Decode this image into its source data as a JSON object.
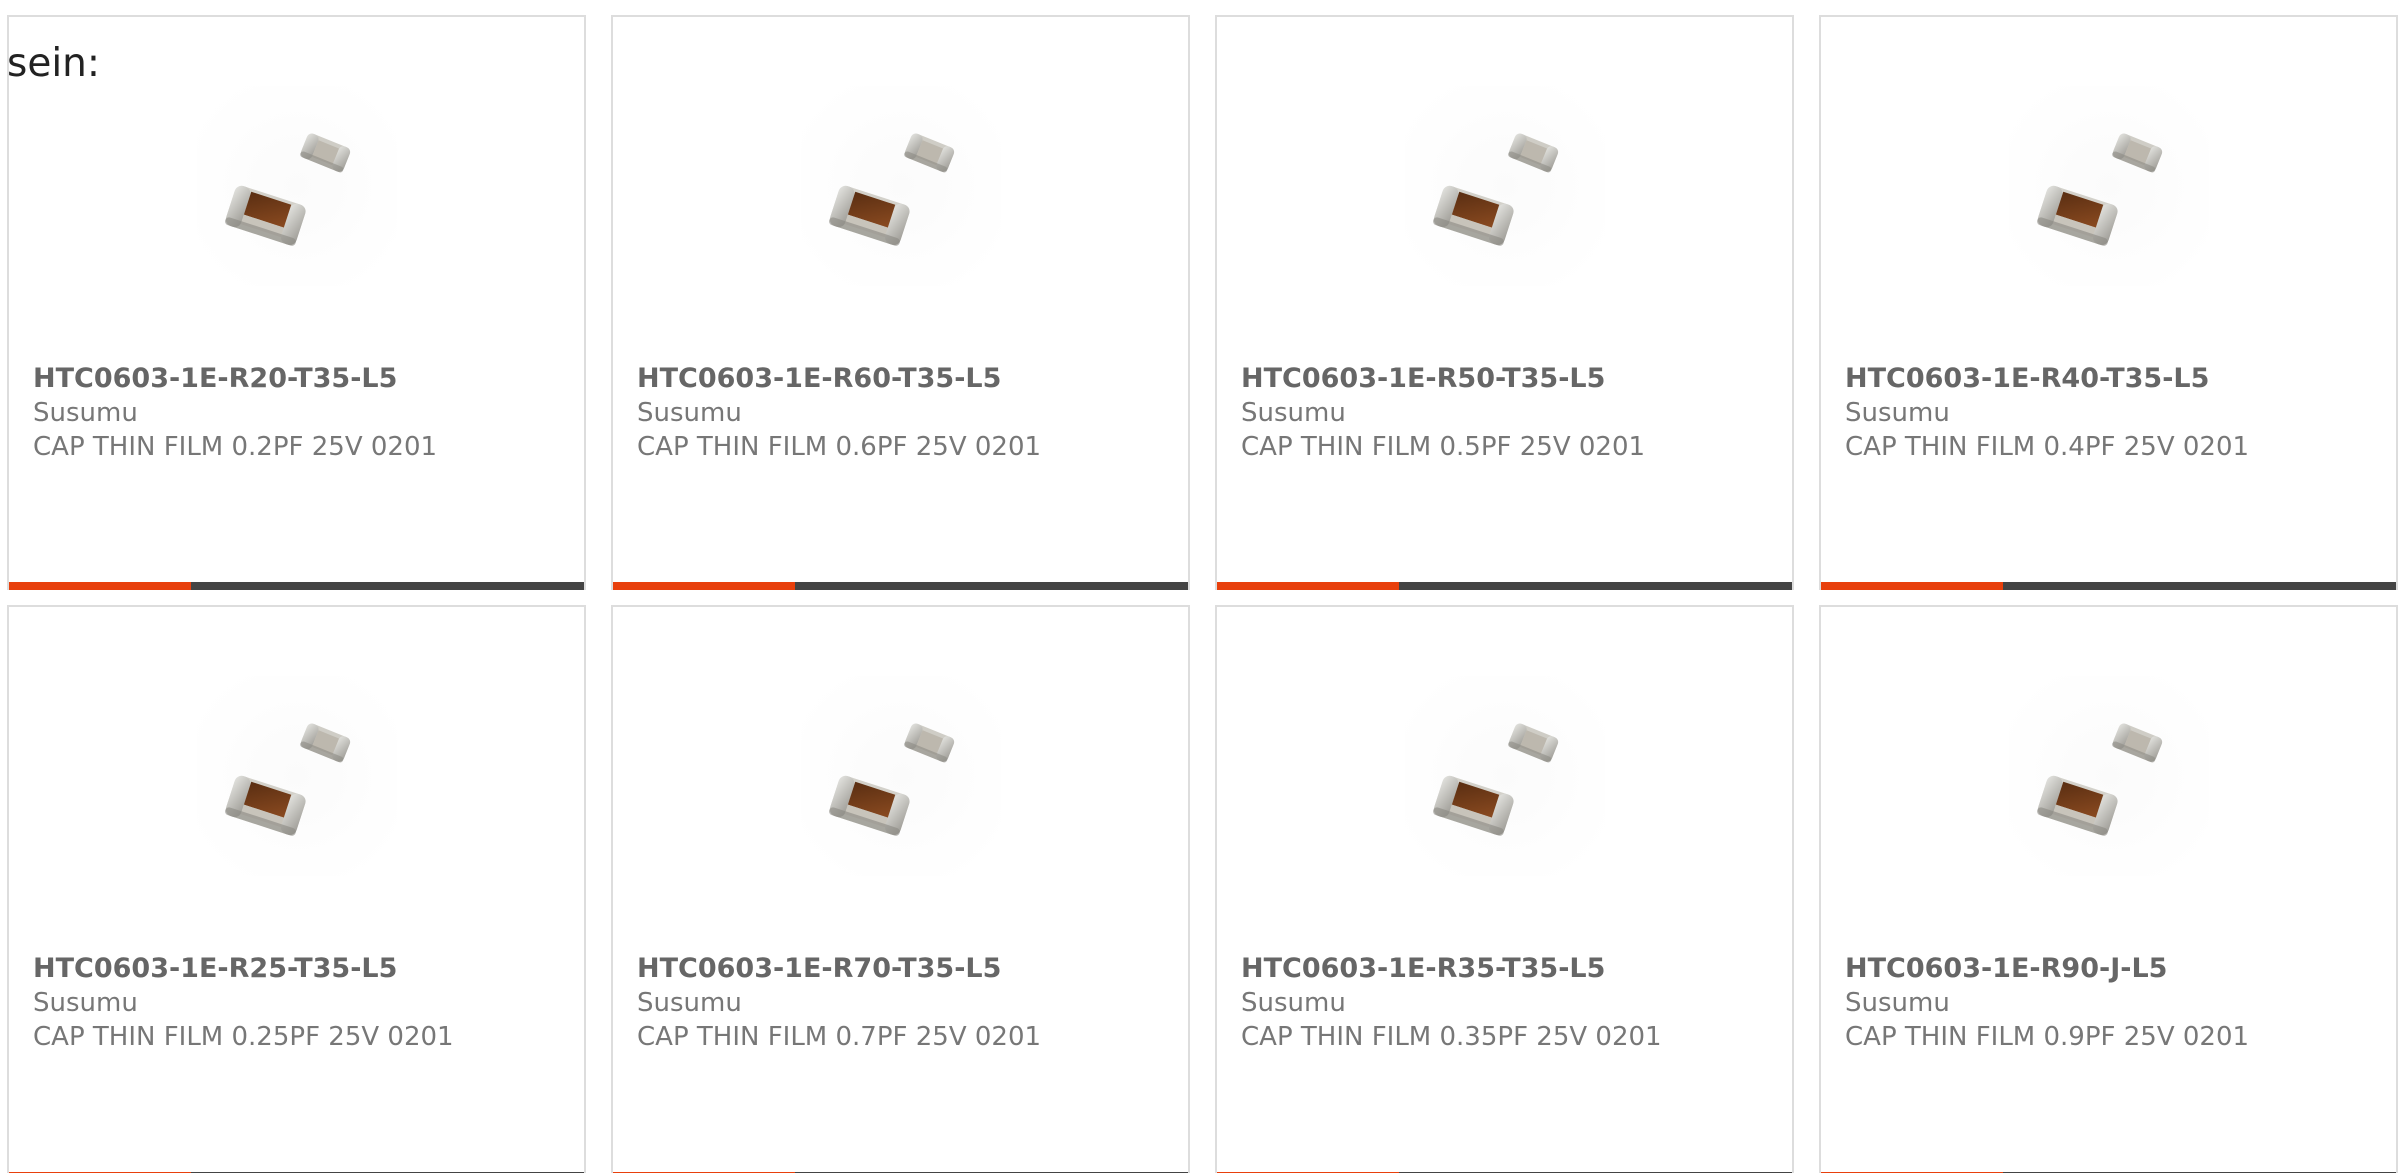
{
  "intro_text": "sein:",
  "colors": {
    "accent": "#e8400c",
    "bar": "#444444",
    "text": "#777777",
    "border": "#dddddd"
  },
  "products": [
    {
      "part_number": "HTC0603-1E-R20-T35-L5",
      "manufacturer": "Susumu",
      "description": "CAP THIN FILM 0.2PF 25V 0201",
      "image": "capacitor-chip-image"
    },
    {
      "part_number": "HTC0603-1E-R60-T35-L5",
      "manufacturer": "Susumu",
      "description": "CAP THIN FILM 0.6PF 25V 0201",
      "image": "capacitor-chip-image"
    },
    {
      "part_number": "HTC0603-1E-R50-T35-L5",
      "manufacturer": "Susumu",
      "description": "CAP THIN FILM 0.5PF 25V 0201",
      "image": "capacitor-chip-image"
    },
    {
      "part_number": "HTC0603-1E-R40-T35-L5",
      "manufacturer": "Susumu",
      "description": "CAP THIN FILM 0.4PF 25V 0201",
      "image": "capacitor-chip-image"
    },
    {
      "part_number": "HTC0603-1E-R25-T35-L5",
      "manufacturer": "Susumu",
      "description": "CAP THIN FILM 0.25PF 25V 0201",
      "image": "capacitor-chip-image"
    },
    {
      "part_number": "HTC0603-1E-R70-T35-L5",
      "manufacturer": "Susumu",
      "description": "CAP THIN FILM 0.7PF 25V 0201",
      "image": "capacitor-chip-image"
    },
    {
      "part_number": "HTC0603-1E-R35-T35-L5",
      "manufacturer": "Susumu",
      "description": "CAP THIN FILM 0.35PF 25V 0201",
      "image": "capacitor-chip-image"
    },
    {
      "part_number": "HTC0603-1E-R90-J-L5",
      "manufacturer": "Susumu",
      "description": "CAP THIN FILM 0.9PF 25V 0201",
      "image": "capacitor-chip-image"
    }
  ]
}
